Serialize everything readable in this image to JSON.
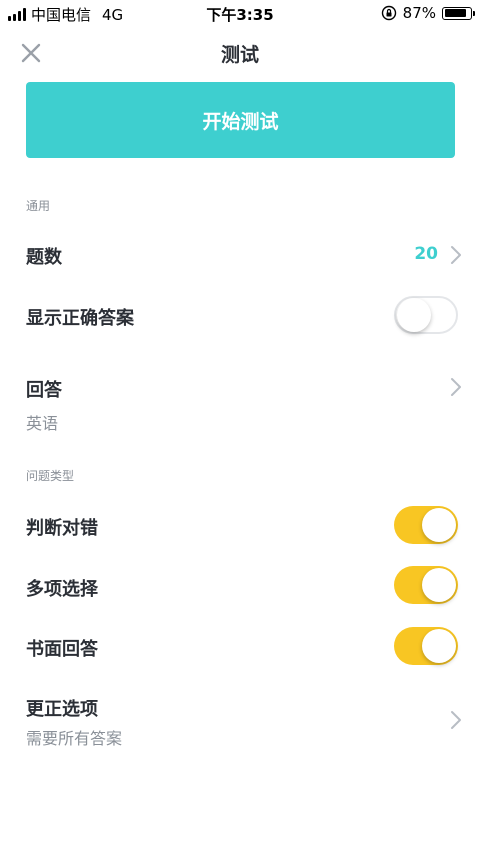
{
  "status_bar": {
    "carrier": "中国电信",
    "network": "4G",
    "time": "下午3:35",
    "battery": "87%",
    "battery_level": 0.87
  },
  "nav": {
    "title": "测试",
    "close_icon": "close-icon"
  },
  "start_button": {
    "label": "开始测试"
  },
  "general": {
    "section_label": "通用",
    "question_count": {
      "label": "题数",
      "value": "20"
    },
    "show_correct_answers": {
      "label": "显示正确答案",
      "enabled": false
    },
    "answer": {
      "label": "回答",
      "value": "英语"
    }
  },
  "question_types": {
    "section_label": "问题类型",
    "items": [
      {
        "label": "判断对错",
        "enabled": true
      },
      {
        "label": "多项选择",
        "enabled": true
      },
      {
        "label": "书面回答",
        "enabled": true
      }
    ]
  },
  "correction_options": {
    "label": "更正选项",
    "value": "需要所有答案"
  },
  "colors": {
    "accent": "#3ecfcf",
    "toggle_on": "#f8c623",
    "text_primary": "#2b2f36",
    "text_secondary": "#8a9098"
  }
}
